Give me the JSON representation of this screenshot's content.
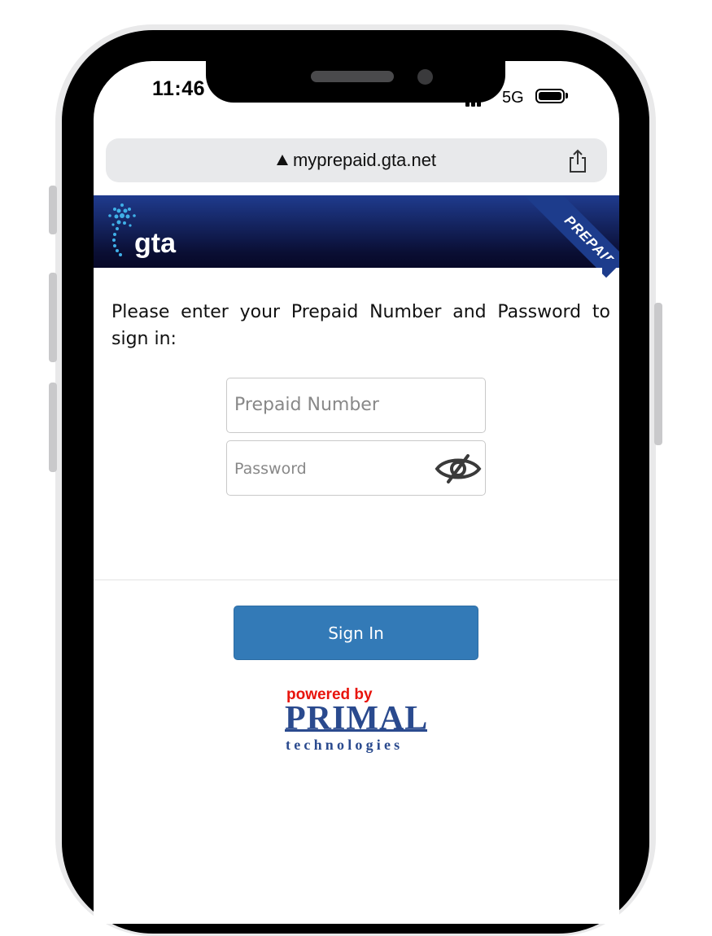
{
  "status_bar": {
    "time": "11:46",
    "network": "5G",
    "icons": [
      "signal-icon",
      "battery-icon"
    ]
  },
  "browser": {
    "url": "myprepaid.gta.net",
    "url_icon": "warning-icon",
    "share_icon": "share-icon"
  },
  "header": {
    "logo_text": "gta",
    "ribbon_text": "PREPAID",
    "colors": {
      "banner": "#0a0e33",
      "ribbon": "#1d3c8c"
    }
  },
  "form": {
    "instructions": "Please enter your Prepaid Number and Password to sign in:",
    "prepaid_placeholder": "Prepaid Number",
    "password_placeholder": "Password",
    "toggle_icon": "eye-slash-icon",
    "signin_label": "Sign In",
    "colors": {
      "button": "#337ab7"
    }
  },
  "footer": {
    "powered_by": "powered by",
    "brand": "PRIMAL",
    "brand_sub": "technologies"
  }
}
